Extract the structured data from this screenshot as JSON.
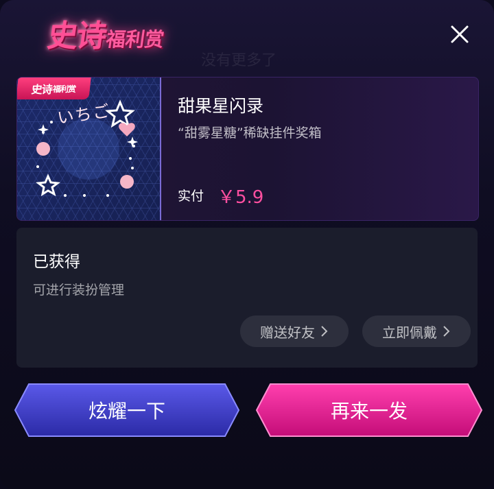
{
  "header": {
    "title_main": "史诗",
    "title_sub": "福利赏",
    "ghost_text": "没有更多了"
  },
  "card": {
    "badge_main": "史诗",
    "badge_sub": "福利赏",
    "thumb_text": "いちご",
    "item_name": "甜果星闪录",
    "item_desc": "“甜雾星糖”稀缺挂件奖箱",
    "price_label": "实付",
    "price_value": "￥5.9"
  },
  "owned": {
    "title": "已获得",
    "subtitle": "可进行装扮管理",
    "gift_label": "赠送好友",
    "wear_label": "立即佩戴"
  },
  "actions": {
    "show_label": "炫耀一下",
    "again_label": "再来一发"
  },
  "colors": {
    "accent_pink": "#ff4fa0",
    "btn_blue": "#3d3cc9",
    "btn_pink": "#e0168c"
  }
}
